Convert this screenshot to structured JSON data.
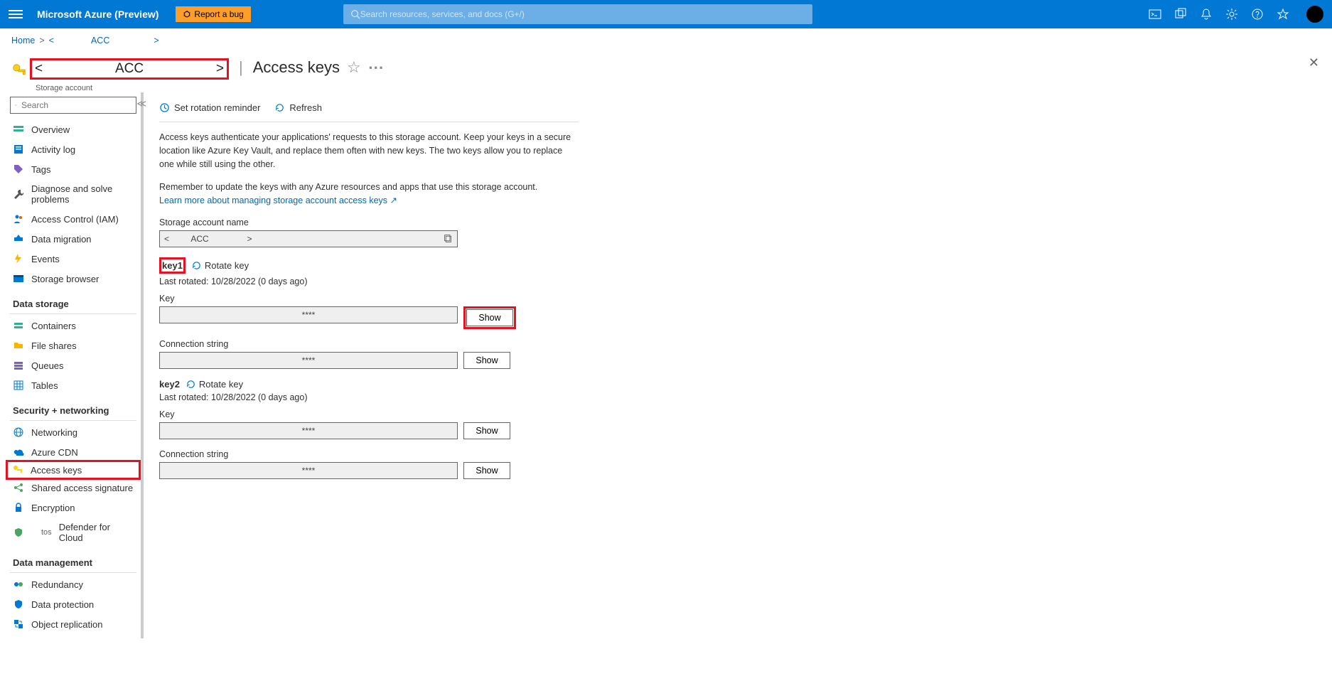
{
  "topbar": {
    "brand": "Microsoft Azure (Preview)",
    "report_bug": "Report a bug",
    "search_placeholder": "Search resources, services, and docs (G+/)"
  },
  "breadcrumb": {
    "home": "Home",
    "sep1": ">",
    "angle1": "<",
    "acc": "ACC",
    "angle2": ">"
  },
  "header": {
    "acc_left": "<",
    "acc_mid": "ACC",
    "acc_right": ">",
    "subtype": "Storage account",
    "title_sep": "|",
    "title": "Access keys"
  },
  "sidesearch_placeholder": "Search",
  "nav": {
    "overview": "Overview",
    "activity": "Activity log",
    "tags": "Tags",
    "diagnose": "Diagnose and solve problems",
    "iam": "Access Control (IAM)",
    "migration": "Data migration",
    "events": "Events",
    "storagebrowser": "Storage browser",
    "sec_datastorage": "Data storage",
    "containers": "Containers",
    "fileshares": "File shares",
    "queues": "Queues",
    "tables": "Tables",
    "sec_security": "Security + networking",
    "networking": "Networking",
    "cdn": "Azure CDN",
    "accesskeys": "Access keys",
    "sas": "Shared access signature",
    "encryption": "Encryption",
    "defender_tos": "tos",
    "defender": "Defender for Cloud",
    "sec_datamgmt": "Data management",
    "redundancy": "Redundancy",
    "dataprotection": "Data protection",
    "objrepl": "Object replication"
  },
  "cmd": {
    "reminder": "Set rotation reminder",
    "refresh": "Refresh"
  },
  "desc": {
    "p1": "Access keys authenticate your applications' requests to this storage account. Keep your keys in a secure location like Azure Key Vault, and replace them often with new keys. The two keys allow you to replace one while still using the other.",
    "p2": "Remember to update the keys with any Azure resources and apps that use this storage account.",
    "link": "Learn more about managing storage account access keys",
    "link_icon": "↗"
  },
  "fields": {
    "acc_label": "Storage account name",
    "acc_value_left": "<",
    "acc_value_mid": "ACC",
    "acc_value_right": ">",
    "key_label": "Key",
    "conn_label": "Connection string",
    "hidden": "****",
    "show": "Show",
    "rotate": "Rotate key"
  },
  "keys": {
    "k1": {
      "name": "key1",
      "rotated": "Last rotated: 10/28/2022 (0 days ago)"
    },
    "k2": {
      "name": "key2",
      "rotated": "Last rotated: 10/28/2022 (0 days ago)"
    }
  }
}
